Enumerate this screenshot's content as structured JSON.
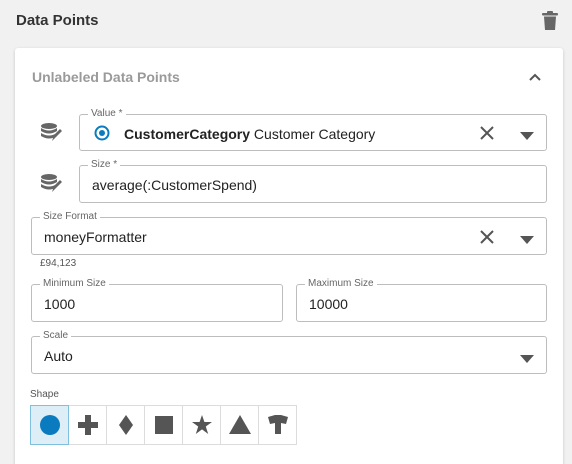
{
  "header": {
    "title": "Data Points",
    "delete_icon": "trash-icon"
  },
  "card": {
    "title": "Unlabeled Data Points",
    "collapse_icon": "chevron-up-icon"
  },
  "value_field": {
    "label": "Value *",
    "bold_value": "CustomerCategory",
    "value": "Customer Category",
    "icon": "target-icon"
  },
  "size_field": {
    "label": "Size *",
    "value": "average(:CustomerSpend)"
  },
  "size_format_field": {
    "label": "Size Format",
    "value": "moneyFormatter",
    "hint": "£94,123"
  },
  "min_size_field": {
    "label": "Minimum Size",
    "value": "1000"
  },
  "max_size_field": {
    "label": "Maximum Size",
    "value": "10000"
  },
  "scale_field": {
    "label": "Scale",
    "value": "Auto"
  },
  "shape": {
    "label": "Shape",
    "options": [
      "circle",
      "cross",
      "diamond",
      "square",
      "star",
      "triangle",
      "shield"
    ],
    "selected": "circle"
  },
  "colors": {
    "accent": "#0a7bbf",
    "icon_gray": "#666666",
    "selected_bg": "#ddeef7"
  }
}
